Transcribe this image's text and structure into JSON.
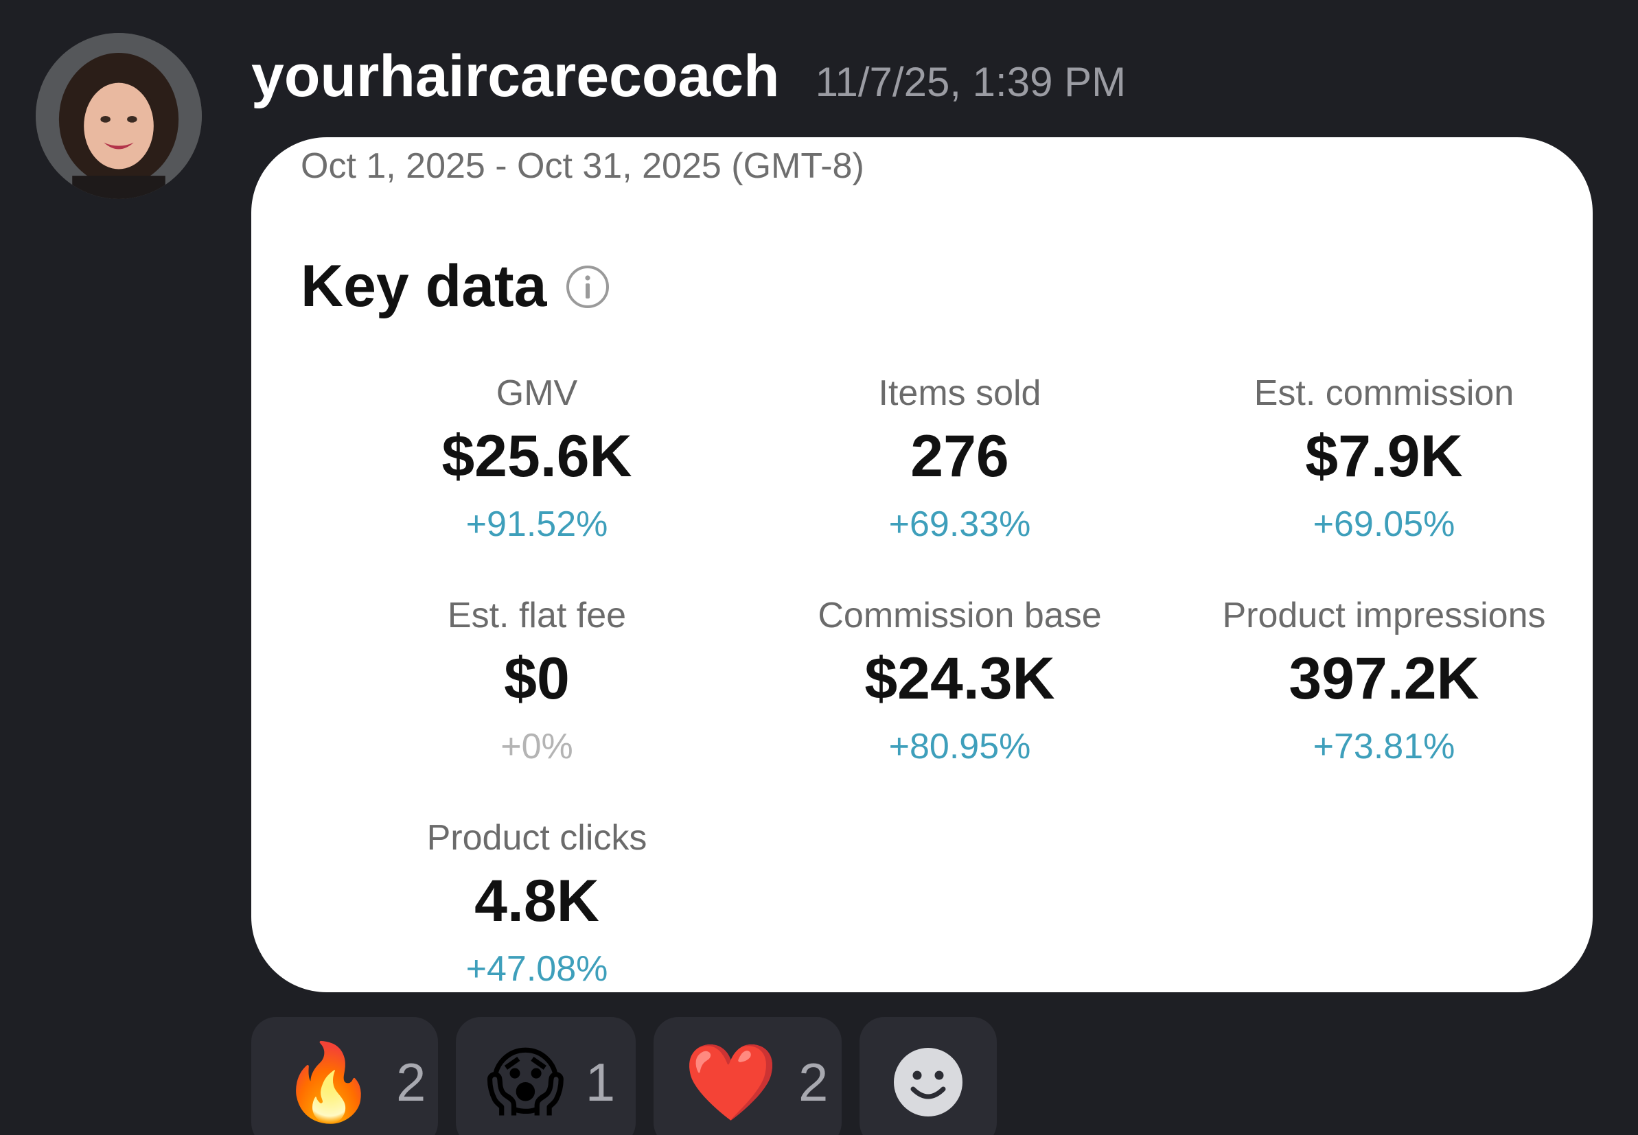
{
  "message": {
    "username": "yourhaircarecoach",
    "timestamp": "11/7/25, 1:39 PM"
  },
  "card": {
    "date_range": "Oct 1, 2025 - Oct 31, 2025 (GMT-8)",
    "title": "Key data",
    "metrics": [
      {
        "label": "GMV",
        "value": "$25.6K",
        "change": "+91.52%"
      },
      {
        "label": "Items sold",
        "value": "276",
        "change": "+69.33%"
      },
      {
        "label": "Est. commission",
        "value": "$7.9K",
        "change": "+69.05%"
      },
      {
        "label": "Est. flat fee",
        "value": "$0",
        "change": "+0%"
      },
      {
        "label": "Commission base",
        "value": "$24.3K",
        "change": "+80.95%"
      },
      {
        "label": "Product impressions",
        "value": "397.2K",
        "change": "+73.81%"
      },
      {
        "label": "Product clicks",
        "value": "4.8K",
        "change": "+47.08%"
      }
    ]
  },
  "reactions": [
    {
      "emoji": "🔥",
      "count": "2"
    },
    {
      "emoji": "😱",
      "count": "1"
    },
    {
      "emoji": "❤️",
      "count": "2"
    }
  ],
  "icons": {
    "info": "info-icon",
    "add_reaction": "smiley-icon"
  },
  "colors": {
    "background": "#1e1f24",
    "positive_change": "#3e9fbb",
    "neutral_change": "#b4b4b4",
    "reaction_bg": "#2b2c33"
  }
}
